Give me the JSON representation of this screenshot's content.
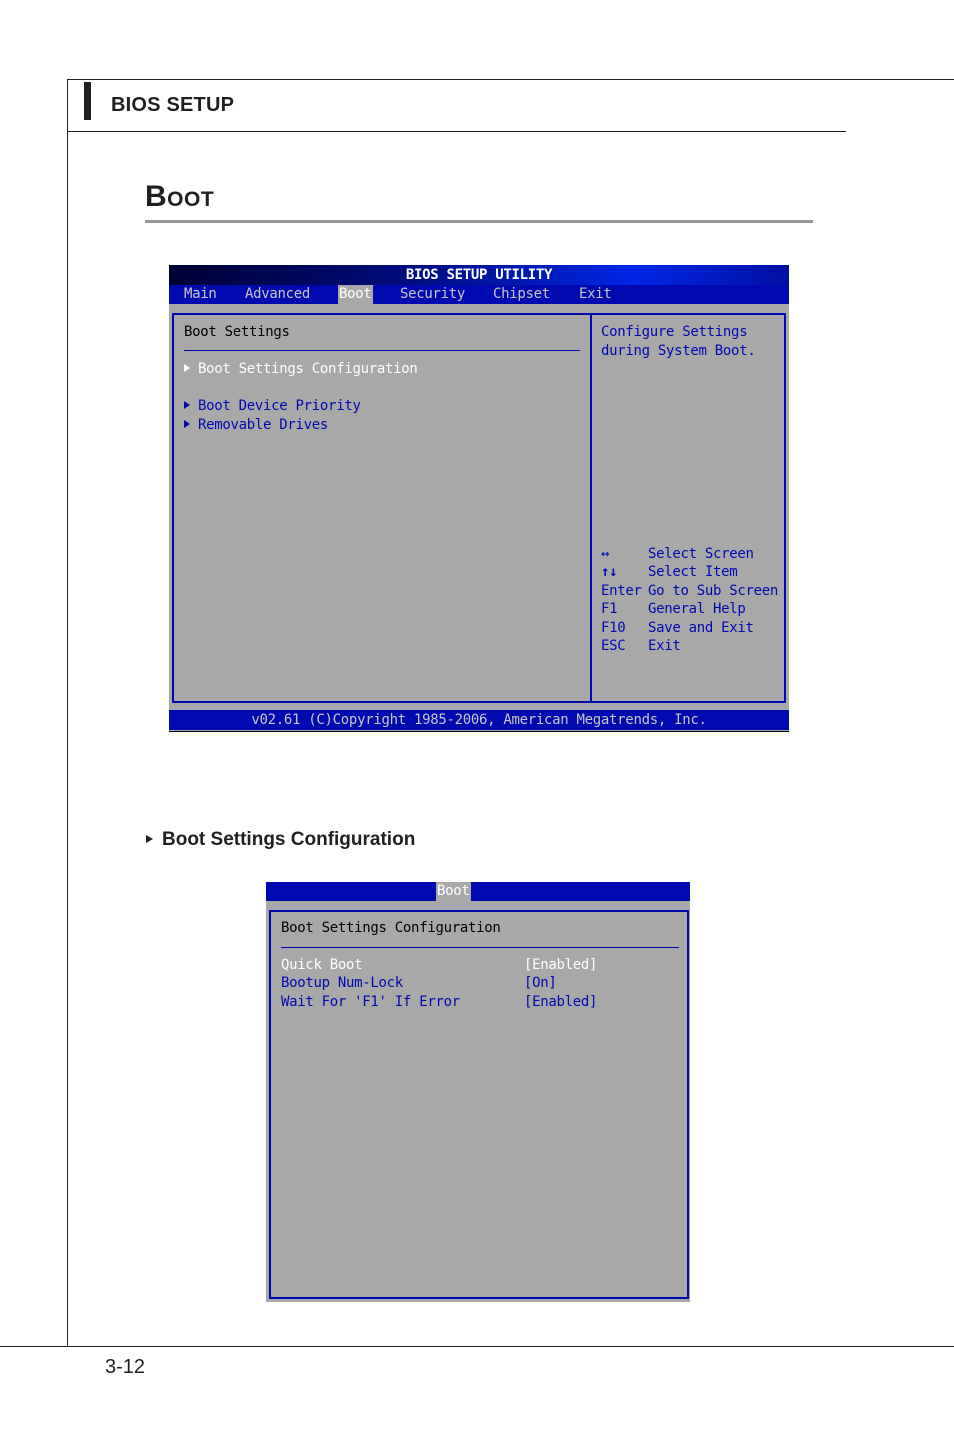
{
  "page": {
    "header": "BIOS SETUP",
    "section_title": "Boot",
    "page_number": "3-12",
    "subsection_title": "Boot Settings Configuration"
  },
  "bios_main": {
    "title": "BIOS SETUP UTILITY",
    "menu": [
      {
        "label": "Main",
        "active": false
      },
      {
        "label": "Advanced",
        "active": false
      },
      {
        "label": "Boot",
        "active": true
      },
      {
        "label": "Security",
        "active": false
      },
      {
        "label": "Chipset",
        "active": false
      },
      {
        "label": "Exit",
        "active": false
      }
    ],
    "heading": "Boot Settings",
    "items": [
      {
        "label": "Boot Settings Configuration",
        "selected": true
      },
      {
        "label": "Boot Device Priority",
        "selected": false
      },
      {
        "label": "Removable Drives",
        "selected": false
      }
    ],
    "help_text": [
      "Configure Settings",
      "during System Boot."
    ],
    "keys": [
      {
        "key": "↔",
        "action": "Select Screen"
      },
      {
        "key": "↑↓",
        "action": "Select Item"
      },
      {
        "key": "Enter",
        "action": "Go to Sub Screen"
      },
      {
        "key": "F1",
        "action": "General Help"
      },
      {
        "key": "F10",
        "action": "Save and Exit"
      },
      {
        "key": "ESC",
        "action": "Exit"
      }
    ],
    "footer": "v02.61 (C)Copyright 1985-2006, American Megatrends, Inc."
  },
  "bios_sub": {
    "menu_active": "Boot",
    "heading": "Boot Settings Configuration",
    "settings": [
      {
        "label": "Quick Boot",
        "value": "[Enabled]",
        "selected": true
      },
      {
        "label": "Bootup Num-Lock",
        "value": "[On]",
        "selected": false
      },
      {
        "label": "Wait For 'F1' If Error",
        "value": "[Enabled]",
        "selected": false
      }
    ]
  },
  "colors": {
    "bios_blue": "#0008b0",
    "bios_gray": "#a8a8a8",
    "highlight": "#ffffff"
  }
}
